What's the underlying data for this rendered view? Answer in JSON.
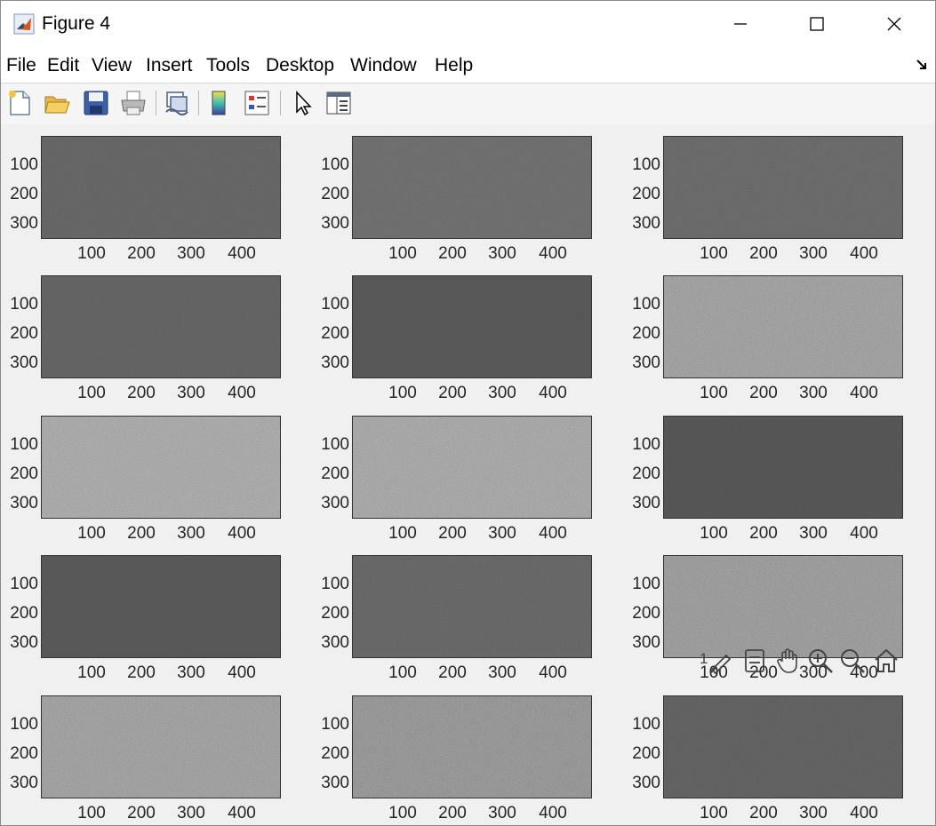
{
  "window": {
    "title": "Figure 4",
    "controls": [
      "minimize",
      "maximize",
      "close"
    ]
  },
  "menu": [
    "File",
    "Edit",
    "View",
    "Insert",
    "Tools",
    "Desktop",
    "Window",
    "Help"
  ],
  "toolbar": {
    "items": [
      "new-figure-icon",
      "open-file-icon",
      "save-icon",
      "print-icon",
      "link-plot-icon",
      "colorbar-icon",
      "legend-icon",
      "select-pointer-icon",
      "property-inspector-icon"
    ]
  },
  "axes_toolbar": {
    "label": "1",
    "items": [
      "brush-icon",
      "data-tips-icon",
      "pan-hand-icon",
      "zoom-in-icon",
      "zoom-out-icon",
      "restore-view-icon"
    ]
  },
  "subplots": {
    "rows": 5,
    "cols": 3,
    "yticks": [
      "100",
      "200",
      "300"
    ],
    "xticks": [
      "100",
      "200",
      "300",
      "400"
    ],
    "brightness": [
      [
        0.43,
        0.47,
        0.45
      ],
      [
        0.42,
        0.37,
        0.52
      ],
      [
        0.56,
        0.55,
        0.36
      ],
      [
        0.37,
        0.44,
        0.5
      ],
      [
        0.52,
        0.48,
        0.41
      ]
    ]
  }
}
